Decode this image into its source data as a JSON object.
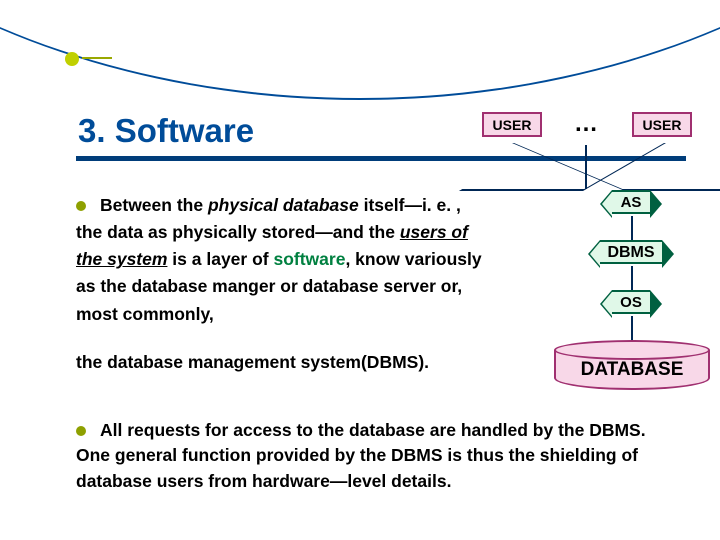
{
  "title": "3. Software",
  "paragraph1": {
    "pre": "Between the ",
    "physical_database": "physical database",
    "mid1": " itself—i. e. , the data as physically stored—and the ",
    "users": "users of the system",
    "mid2": " is a layer of ",
    "software": "software",
    "post": ", know variously as the database manger or database server or, most commonly,"
  },
  "paragraph2": "the database management system(DBMS).",
  "paragraph3": "All requests for access to the database are handled by the DBMS. One general function provided by the DBMS is thus the shielding of database users from hardware—level details.",
  "diagram": {
    "user_left": "USER",
    "ellipsis": "…",
    "user_right": "USER",
    "as": "AS",
    "dbms": "DBMS",
    "os": "OS",
    "database": "DATABASE"
  }
}
